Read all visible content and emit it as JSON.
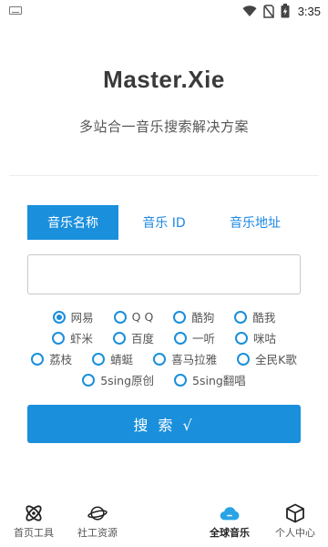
{
  "status_bar": {
    "time": "3:35",
    "icons": [
      "keyboard-icon",
      "wifi-icon",
      "no-sim-icon",
      "battery-charging-icon"
    ]
  },
  "header": {
    "title": "Master.Xie",
    "subtitle": "多站合一音乐搜索解决方案"
  },
  "tabs": [
    {
      "label": "音乐名称",
      "active": true
    },
    {
      "label": "音乐 ID",
      "active": false
    },
    {
      "label": "音乐地址",
      "active": false
    }
  ],
  "search": {
    "value": "",
    "placeholder": "",
    "button_label": "搜 索 √"
  },
  "sources": {
    "selected": "网易",
    "rows": [
      [
        "网易",
        "Q Q",
        "酷狗",
        "酷我"
      ],
      [
        "虾米",
        "百度",
        "一听",
        "咪咕"
      ],
      [
        "荔枝",
        "蜻蜓",
        "喜马拉雅",
        "全民K歌"
      ],
      [
        "5sing原创",
        "5sing翻唱"
      ]
    ]
  },
  "bottom_nav": [
    {
      "label": "首页工具",
      "icon": "atom-icon",
      "active": false
    },
    {
      "label": "社工资源",
      "icon": "planet-icon",
      "active": false
    },
    {
      "label": "全球音乐",
      "icon": "cloud-icon",
      "active": true
    },
    {
      "label": "个人中心",
      "icon": "cube-icon",
      "active": false
    }
  ],
  "colors": {
    "accent": "#1a8fdc",
    "text": "#333333",
    "muted": "#555555"
  }
}
